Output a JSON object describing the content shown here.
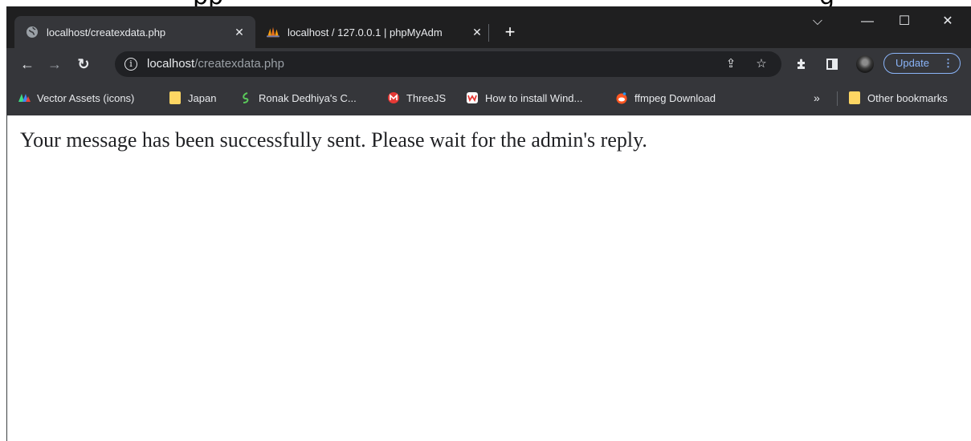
{
  "tabs": [
    {
      "title": "localhost/createxdata.php",
      "favicon": "globe-icon",
      "active": true
    },
    {
      "title": "localhost / 127.0.0.1 | phpMyAdm",
      "favicon": "phpmyadmin-icon",
      "active": false
    }
  ],
  "tab_close_glyph": "✕",
  "new_tab_glyph": "+",
  "window_controls": {
    "tab_search": "⌵",
    "minimize": "—",
    "maximize": "☐",
    "close": "✕"
  },
  "address_bar": {
    "host": "localhost",
    "path": "/createxdata.php"
  },
  "update_button_label": "Update",
  "bookmarks": [
    {
      "label": "Vector Assets (icons)",
      "icon": "vector-assets-icon"
    },
    {
      "label": "Japan",
      "icon": "folder-icon"
    },
    {
      "label": "Ronak Dedhiya's C...",
      "icon": "ronak-icon"
    },
    {
      "label": "ThreeJS",
      "icon": "threejs-icon"
    },
    {
      "label": "How to install Wind...",
      "icon": "wind-icon"
    },
    {
      "label": "ffmpeg Download",
      "icon": "ffmpeg-icon"
    }
  ],
  "bookmarks_overflow": "»",
  "other_bookmarks_label": "Other bookmarks",
  "page_message": "Your message has been successfully sent. Please wait for the admin's reply.",
  "colors": {
    "chrome_bg": "#202124",
    "toolbar_bg": "#35363a",
    "accent": "#8ab4f8",
    "folder": "#fdd663"
  }
}
